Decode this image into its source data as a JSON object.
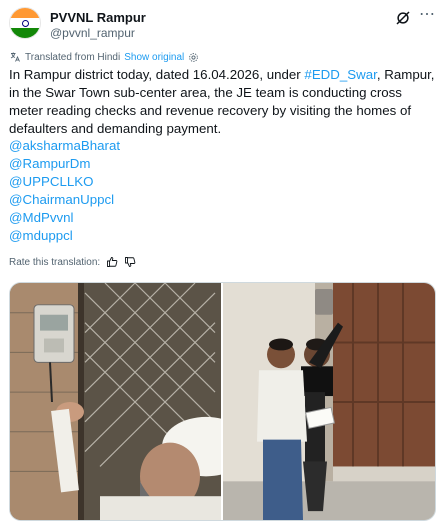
{
  "account": {
    "display_name": "PVVNL Rampur",
    "handle": "@pvvnl_rampur",
    "avatar": "india-flag"
  },
  "translation": {
    "label": "Translated from Hindi",
    "show_original": "Show original"
  },
  "tweet": {
    "before_hashtag": "In Rampur district today, dated 16.04.2026, under ",
    "hashtag": "#EDD_Swar",
    "after_hashtag": ", Rampur, in the Swar Town sub-center area, the JE team is conducting cross meter reading checks and revenue recovery by visiting the homes of defaulters and demanding payment.",
    "mentions": [
      "@aksharmaBharat",
      "@RampurDm",
      "@UPPCLLKO",
      "@ChairmanUppcl",
      "@MdPvvnl",
      "@mduppcl"
    ]
  },
  "rate": {
    "label": "Rate this translation:"
  },
  "colors": {
    "link": "#1d9bf0",
    "text": "#0f1419",
    "muted": "#536471"
  }
}
